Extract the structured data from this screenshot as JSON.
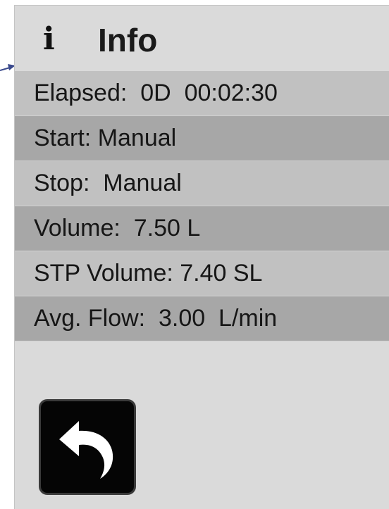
{
  "header": {
    "icon": "info-icon",
    "icon_glyph": "i",
    "title": "Info"
  },
  "rows": [
    {
      "label": "Elapsed:  0D  00:02:30"
    },
    {
      "label": "Start: Manual"
    },
    {
      "label": "Stop:  Manual"
    },
    {
      "label": "Volume:  7.50 L"
    },
    {
      "label": "STP Volume: 7.40 SL"
    },
    {
      "label": "Avg. Flow:  3.00  L/min"
    }
  ],
  "back_button": {
    "icon": "back-arrow-icon"
  },
  "colors": {
    "panel_background": "#dadada",
    "row_light": "#c1c1c1",
    "row_dark": "#a7a7a7",
    "pointer_arrow": "#3b4a8c"
  }
}
